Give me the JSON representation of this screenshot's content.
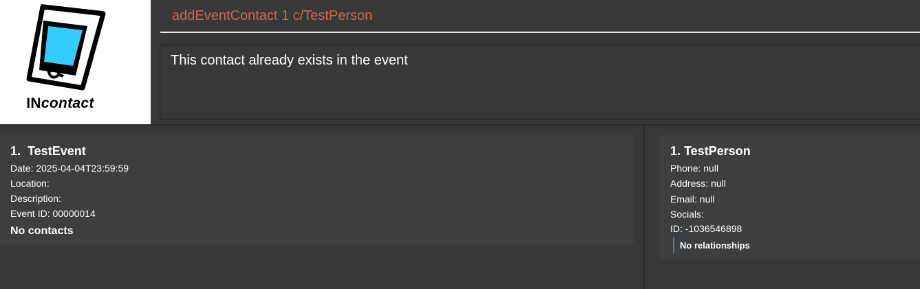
{
  "logo": {
    "prefix": "IN",
    "suffix": "contact",
    "icon": "phone-device-icon",
    "screen_color": "#33ccff"
  },
  "command": {
    "value": "addEventContact 1 c/TestPerson",
    "color": "#d06651"
  },
  "result": {
    "message": "This contact already exists in the event"
  },
  "events": [
    {
      "title": "1.  TestEvent",
      "date": "Date: 2025-04-04T23:59:59",
      "location": "Location:",
      "description": "Description:",
      "event_id": "Event ID: 00000014",
      "contacts": "No contacts"
    }
  ],
  "persons": [
    {
      "title": "1. TestPerson",
      "phone": "Phone: null",
      "address": "Address: null",
      "email": "Email: null",
      "socials": "Socials:",
      "id": "ID: -1036546898",
      "relationships": "No relationships"
    }
  ],
  "colors": {
    "background": "#383838",
    "card": "#3c3e3f",
    "accent_relationship": "#4d7c99"
  }
}
